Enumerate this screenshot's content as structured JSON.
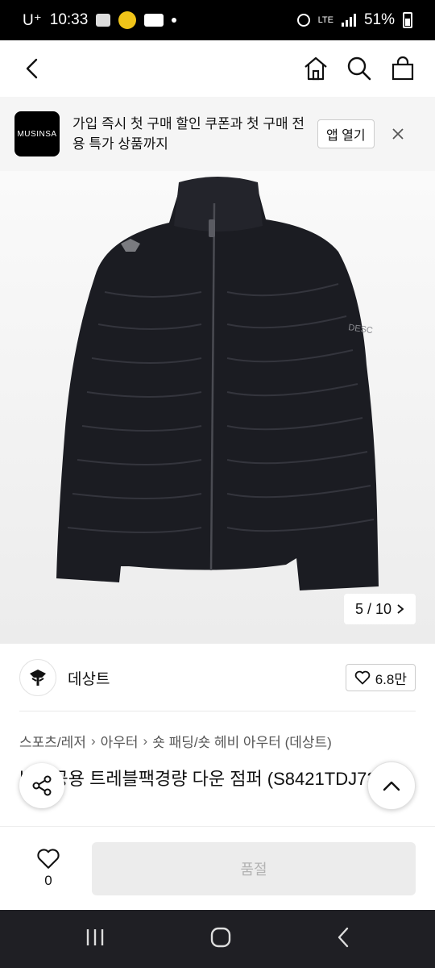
{
  "status_bar": {
    "carrier": "U⁺",
    "time": "10:33",
    "network": "LTE",
    "battery": "51%"
  },
  "header": {
    "icons": [
      "back-icon",
      "home-icon",
      "search-icon",
      "bag-icon"
    ]
  },
  "banner": {
    "logo_text": "MUSINSA",
    "message": "가입 즉시 첫 구매 할인 쿠폰과 첫 구매 전용 특가 상품까지",
    "open_app_label": "앱 열기"
  },
  "product_image": {
    "counter": "5 / 10",
    "sleeve_text": "DESC"
  },
  "brand": {
    "name": "데상트",
    "likes": "6.8만"
  },
  "breadcrumb": [
    "스포츠/레저",
    "아우터",
    "숏 패딩/숏 헤비 아우터 (데상트)"
  ],
  "product_title": "남녀공용 트레블팩경량 다운 점퍼 (S8421TDJ73)",
  "bottom_bar": {
    "wish_count": "0",
    "soldout_label": "품절"
  },
  "colors": {
    "accent": "#000000",
    "soldout_bg": "#ececec",
    "soldout_text": "#b3b3b3",
    "navbar": "#1f1f24"
  }
}
